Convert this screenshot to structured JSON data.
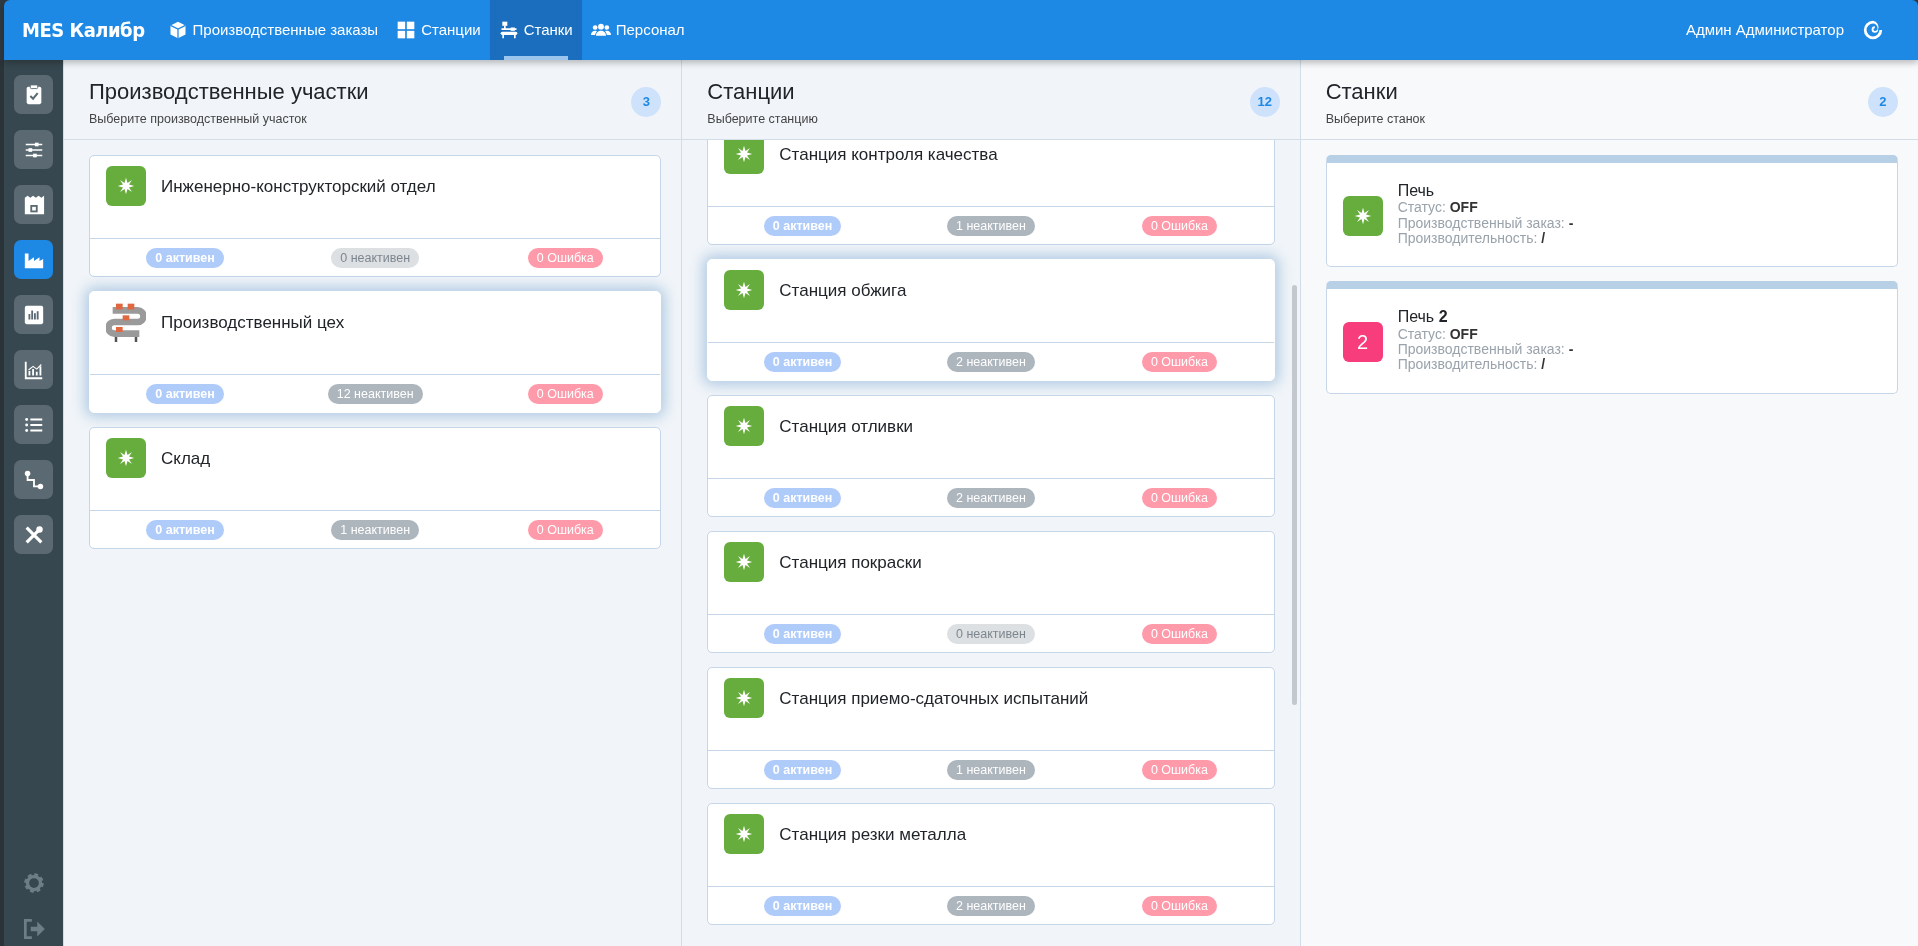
{
  "navbar": {
    "brand": "MES Калибр",
    "items": [
      {
        "label": "Производственные заказы",
        "selected": false
      },
      {
        "label": "Станции",
        "selected": false
      },
      {
        "label": "Станки",
        "selected": true
      },
      {
        "label": "Персонал",
        "selected": false
      }
    ],
    "user": "Админ Администратор"
  },
  "sidebar": {
    "items": [
      {
        "selected": false
      },
      {
        "selected": false
      },
      {
        "selected": false
      },
      {
        "selected": true
      },
      {
        "selected": false
      },
      {
        "selected": false
      },
      {
        "selected": false
      },
      {
        "selected": false
      },
      {
        "selected": false
      }
    ]
  },
  "areas": {
    "title": "Производственные участки",
    "subtitle": "Выберите производственный участок",
    "count": "3",
    "items": [
      {
        "name": "Инженерно-конструкторский отдел",
        "kind": "star",
        "selected": false,
        "badges": [
          {
            "kind": "active",
            "text": "0 активен",
            "dimmed": true
          },
          {
            "kind": "inactive",
            "text": "0 неактивен",
            "dimmed": true
          },
          {
            "kind": "error",
            "text": "0 Ошибка",
            "dimmed": true
          }
        ]
      },
      {
        "name": "Производственный цех",
        "kind": "conveyor",
        "selected": true,
        "badges": [
          {
            "kind": "active",
            "text": "0 активен",
            "dimmed": true
          },
          {
            "kind": "inactive",
            "text": "12 неактивен",
            "dimmed": false
          },
          {
            "kind": "error",
            "text": "0 Ошибка",
            "dimmed": true
          }
        ]
      },
      {
        "name": "Склад",
        "kind": "star",
        "selected": false,
        "badges": [
          {
            "kind": "active",
            "text": "0 активен",
            "dimmed": true
          },
          {
            "kind": "inactive",
            "text": "1 неактивен",
            "dimmed": false
          },
          {
            "kind": "error",
            "text": "0 Ошибка",
            "dimmed": true
          }
        ]
      }
    ]
  },
  "stations": {
    "title": "Станции",
    "subtitle": "Выберите станцию",
    "count": "12",
    "items": [
      {
        "name": "Станция контроля качества",
        "kind": "star",
        "selected": false,
        "badges": [
          {
            "kind": "active",
            "text": "0 активен",
            "dimmed": true
          },
          {
            "kind": "inactive",
            "text": "1 неактивен",
            "dimmed": false
          },
          {
            "kind": "error",
            "text": "0 Ошибка",
            "dimmed": true
          }
        ]
      },
      {
        "name": "Станция обжига",
        "kind": "star",
        "selected": true,
        "badges": [
          {
            "kind": "active",
            "text": "0 активен",
            "dimmed": true
          },
          {
            "kind": "inactive",
            "text": "2 неактивен",
            "dimmed": false
          },
          {
            "kind": "error",
            "text": "0 Ошибка",
            "dimmed": true
          }
        ]
      },
      {
        "name": "Станция отливки",
        "kind": "star",
        "selected": false,
        "badges": [
          {
            "kind": "active",
            "text": "0 активен",
            "dimmed": true
          },
          {
            "kind": "inactive",
            "text": "2 неактивен",
            "dimmed": false
          },
          {
            "kind": "error",
            "text": "0 Ошибка",
            "dimmed": true
          }
        ]
      },
      {
        "name": "Станция покраски",
        "kind": "star",
        "selected": false,
        "badges": [
          {
            "kind": "active",
            "text": "0 активен",
            "dimmed": true
          },
          {
            "kind": "inactive",
            "text": "0 неактивен",
            "dimmed": true
          },
          {
            "kind": "error",
            "text": "0 Ошибка",
            "dimmed": true
          }
        ]
      },
      {
        "name": "Станция приемо-сдаточных испытаний",
        "kind": "star",
        "selected": false,
        "badges": [
          {
            "kind": "active",
            "text": "0 активен",
            "dimmed": true
          },
          {
            "kind": "inactive",
            "text": "1 неактивен",
            "dimmed": false
          },
          {
            "kind": "error",
            "text": "0 Ошибка",
            "dimmed": true
          }
        ]
      },
      {
        "name": "Станция резки металла",
        "kind": "star",
        "selected": false,
        "badges": [
          {
            "kind": "active",
            "text": "0 активен",
            "dimmed": true
          },
          {
            "kind": "inactive",
            "text": "2 неактивен",
            "dimmed": false
          },
          {
            "kind": "error",
            "text": "0 Ошибка",
            "dimmed": true
          }
        ]
      }
    ]
  },
  "machines": {
    "title": "Станки",
    "subtitle": "Выберите станок",
    "count": "2",
    "items": [
      {
        "name": "Печь",
        "kind": "icon",
        "fields": [
          {
            "label": "Статус:",
            "value": "OFF"
          },
          {
            "label": "Производственный заказ:",
            "value": "-"
          },
          {
            "label": "Производительность:",
            "value": "/"
          }
        ]
      },
      {
        "name": "Печь **2**",
        "kind": "number",
        "mark": "2",
        "fields": [
          {
            "label": "Статус:",
            "value": "OFF"
          },
          {
            "label": "Производственный заказ:",
            "value": "-"
          },
          {
            "label": "Производительность:",
            "value": "/"
          }
        ]
      }
    ]
  }
}
